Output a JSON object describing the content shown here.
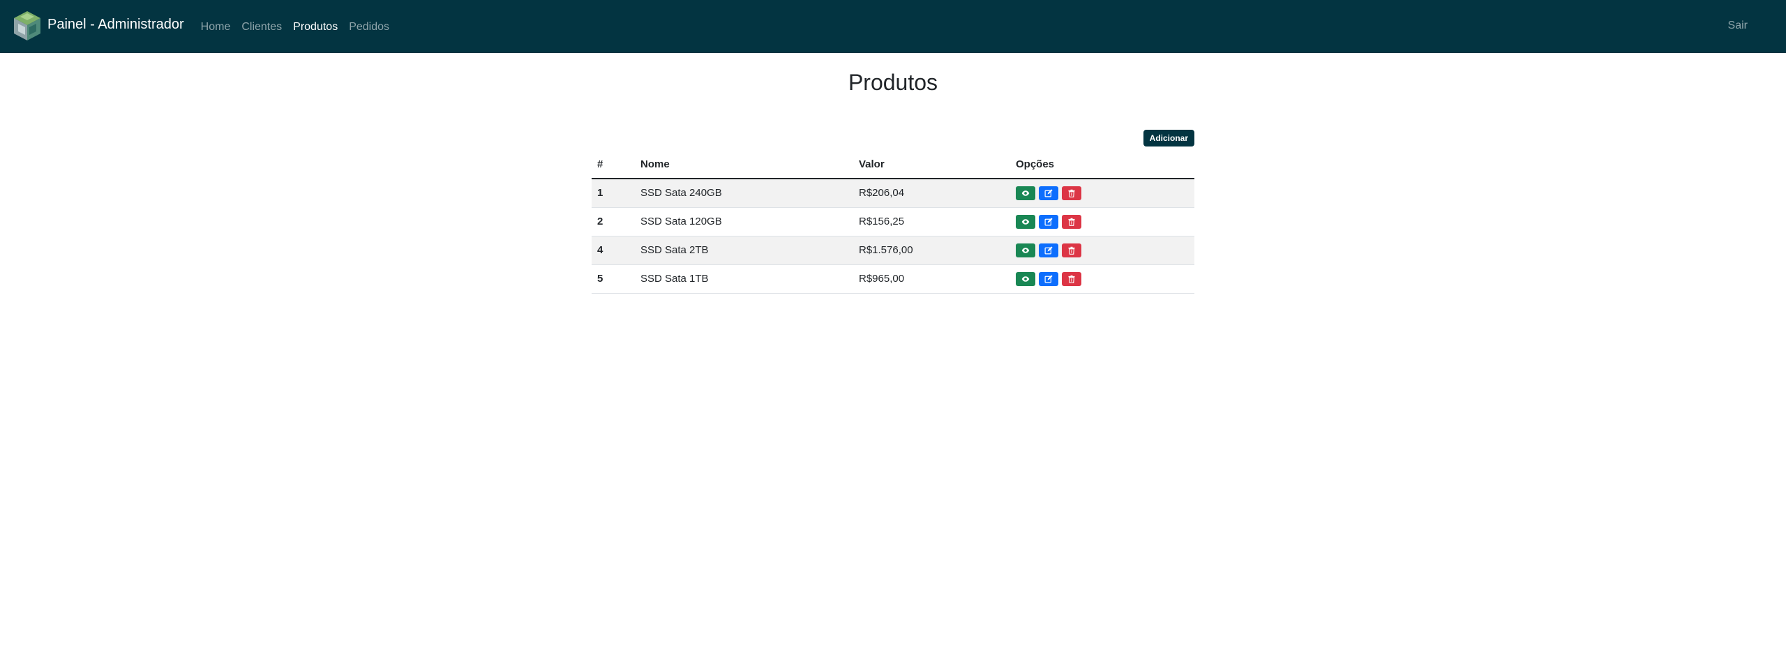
{
  "navbar": {
    "brand": "Painel - Administrador",
    "links": [
      {
        "label": "Home",
        "active": false
      },
      {
        "label": "Clientes",
        "active": false
      },
      {
        "label": "Produtos",
        "active": true
      },
      {
        "label": "Pedidos",
        "active": false
      }
    ],
    "logout": "Sair"
  },
  "page": {
    "title": "Produtos",
    "add_button": "Adicionar"
  },
  "table": {
    "headers": [
      "#",
      "Nome",
      "Valor",
      "Opções"
    ],
    "rows": [
      {
        "id": "1",
        "nome": "SSD Sata 240GB",
        "valor": "R$206,04"
      },
      {
        "id": "2",
        "nome": "SSD Sata 120GB",
        "valor": "R$156,25"
      },
      {
        "id": "4",
        "nome": "SSD Sata 2TB",
        "valor": "R$1.576,00"
      },
      {
        "id": "5",
        "nome": "SSD Sata 1TB",
        "valor": "R$965,00"
      }
    ],
    "row_actions": [
      "eye-icon",
      "edit-icon",
      "trash-icon"
    ]
  },
  "colors": {
    "navbar": "#033441",
    "view": "#198754",
    "edit": "#0d6efd",
    "delete": "#dc3545"
  }
}
